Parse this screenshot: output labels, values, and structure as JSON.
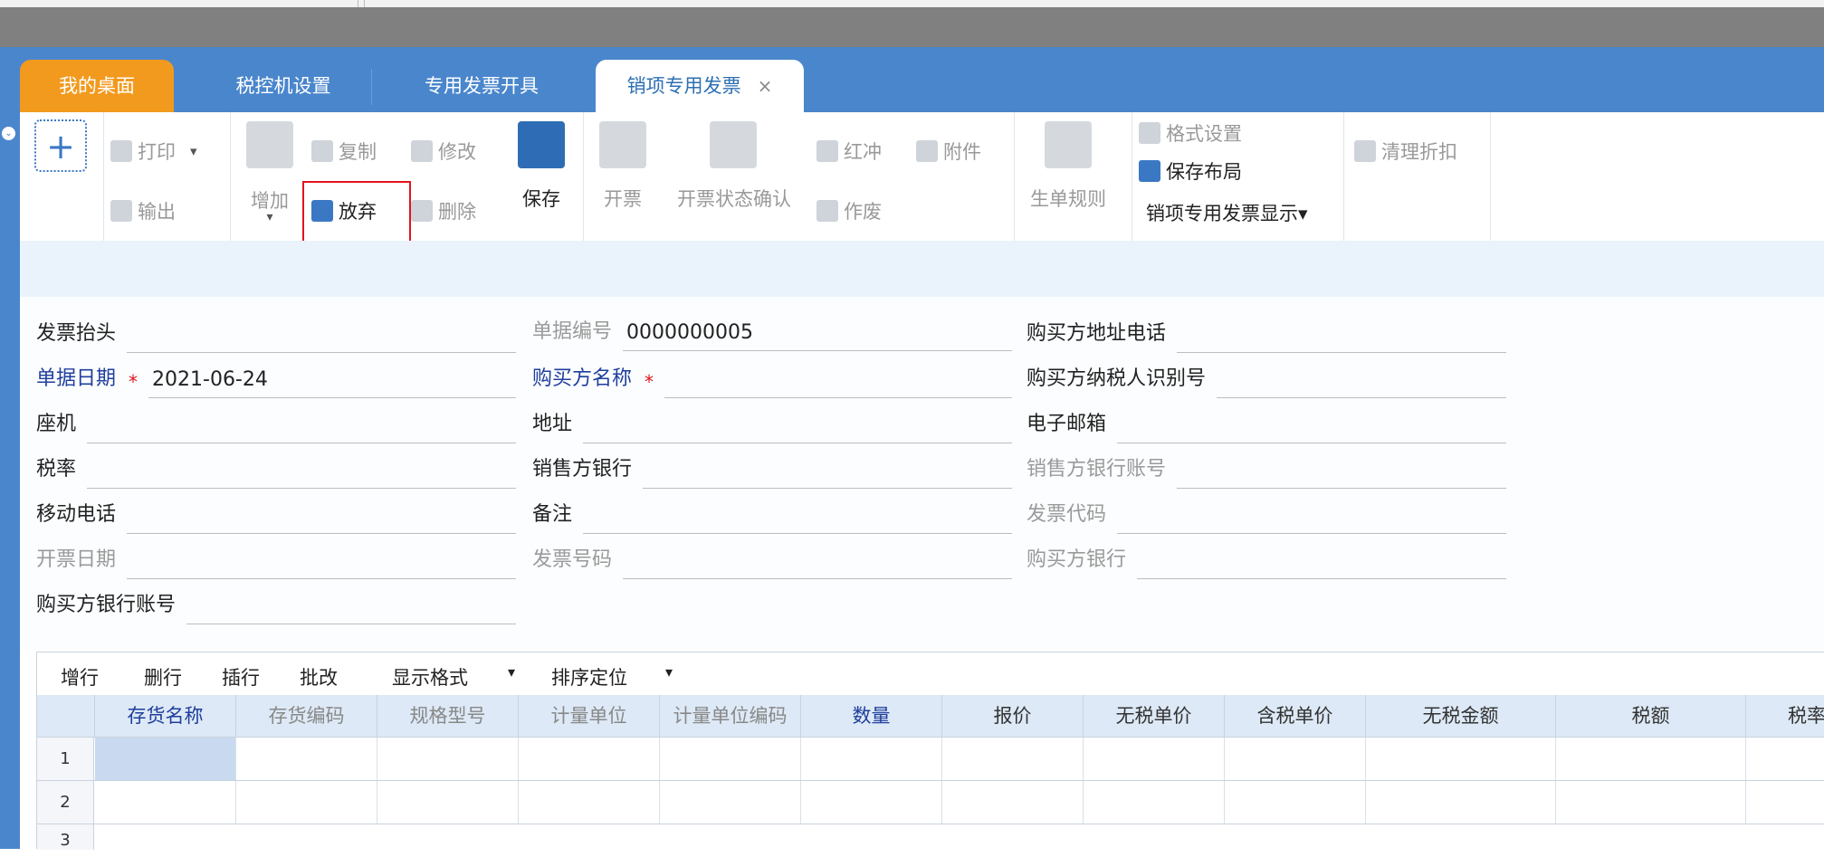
{
  "tabs": [
    {
      "label": "我的桌面",
      "state": "home"
    },
    {
      "label": "税控机设置",
      "state": "normal"
    },
    {
      "label": "专用发票开具",
      "state": "normal"
    },
    {
      "label": "销项专用发票",
      "state": "active",
      "close": "×"
    }
  ],
  "toolbar": {
    "add_label": "+",
    "print": "打印",
    "print_caret": "▾",
    "export": "输出",
    "add": "增加",
    "add_caret": "▾",
    "copy": "复制",
    "modify": "修改",
    "abandon": "放弃",
    "delete": "删除",
    "save": "保存",
    "issue": "开票",
    "issue_confirm": "开票状态确认",
    "red_reverse": "红冲",
    "attachment": "附件",
    "void": "作废",
    "rule": "生单规则",
    "format_settings": "格式设置",
    "save_layout": "保存布局",
    "display": "销项专用发票显示▾",
    "clear_discount": "清理折扣"
  },
  "form": {
    "invoice_title": {
      "label": "发票抬头",
      "value": ""
    },
    "doc_no": {
      "label": "单据编号",
      "value": "0000000005"
    },
    "buyer_addr_phone": {
      "label": "购买方地址电话",
      "value": ""
    },
    "doc_date": {
      "label": "单据日期",
      "value": "2021-06-24",
      "star": "*"
    },
    "buyer_name": {
      "label": "购买方名称",
      "value": "",
      "star": "*"
    },
    "buyer_taxid": {
      "label": "购买方纳税人识别号",
      "value": ""
    },
    "landline": {
      "label": "座机",
      "value": ""
    },
    "address": {
      "label": "地址",
      "value": ""
    },
    "email": {
      "label": "电子邮箱",
      "value": ""
    },
    "tax_rate": {
      "label": "税率",
      "value": ""
    },
    "seller_bank": {
      "label": "销售方银行",
      "value": ""
    },
    "seller_bank_acct": {
      "label": "销售方银行账号",
      "value": ""
    },
    "mobile": {
      "label": "移动电话",
      "value": ""
    },
    "remark": {
      "label": "备注",
      "value": ""
    },
    "invoice_code": {
      "label": "发票代码",
      "value": ""
    },
    "issue_date": {
      "label": "开票日期",
      "value": ""
    },
    "invoice_number": {
      "label": "发票号码",
      "value": ""
    },
    "buyer_bank": {
      "label": "购买方银行",
      "value": ""
    },
    "buyer_bank_acct": {
      "label": "购买方银行账号",
      "value": ""
    }
  },
  "grid": {
    "toolbar": {
      "add_row": "增行",
      "del_row": "删行",
      "insert_row": "插行",
      "batch": "批改",
      "display_fmt": "显示格式",
      "sort": "排序定位",
      "caret": "▾"
    },
    "columns": [
      "存货名称",
      "存货编码",
      "规格型号",
      "计量单位",
      "计量单位编码",
      "数量",
      "报价",
      "无税单价",
      "含税单价",
      "无税金额",
      "税额",
      "税率"
    ],
    "rows": [
      "1",
      "2",
      "3"
    ]
  },
  "colors": {
    "tabbar": "#4a86cc",
    "home_tab": "#f29a1e",
    "required_label": "#1f3e9c",
    "highlight": "#e0151b"
  }
}
